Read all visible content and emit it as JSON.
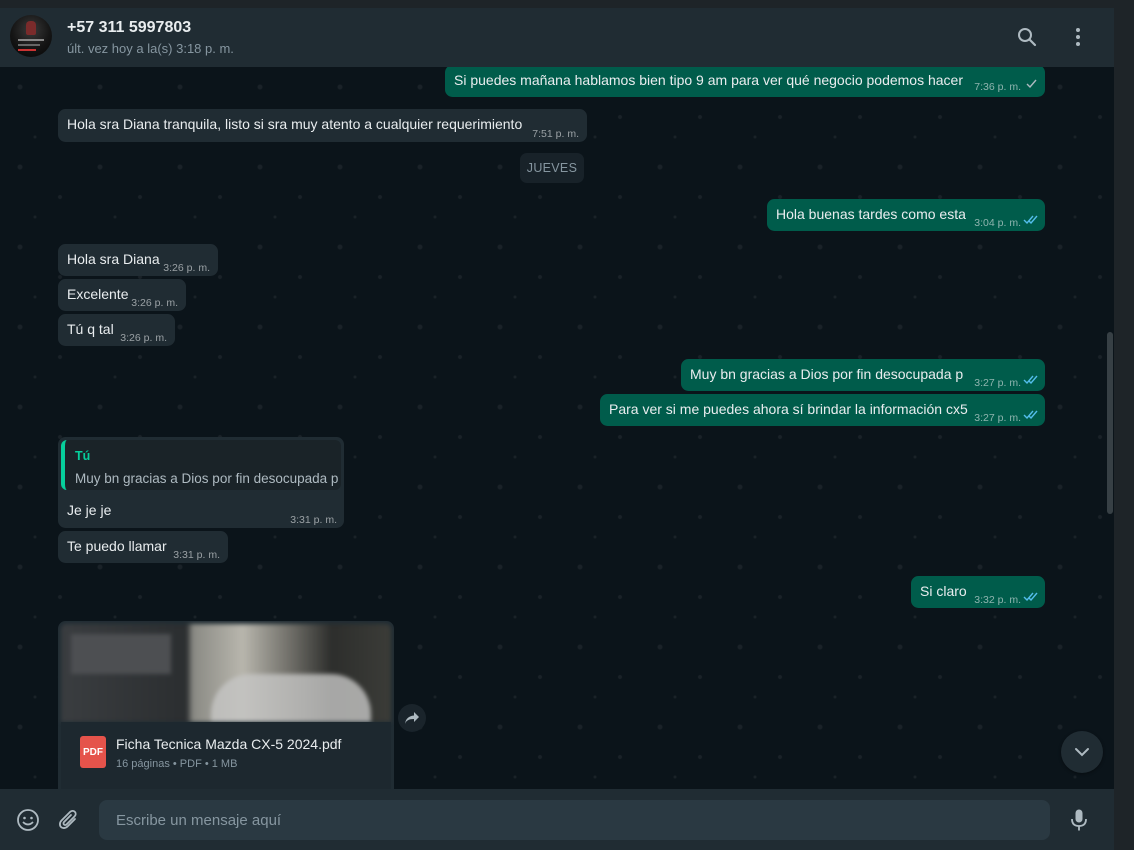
{
  "header": {
    "contact_name": "+57 311 5997803",
    "last_seen": "últ. vez hoy a la(s) 3:18 p. m.",
    "search_icon": "search-icon",
    "menu_icon": "more-vertical-icon"
  },
  "day_separator": "JUEVES",
  "messages": [
    {
      "dir": "out",
      "text": "Si puedes mañana hablamos bien tipo 9 am para ver qué negocio podemos hacer",
      "time": "7:36 p. m.",
      "status": "sent"
    },
    {
      "dir": "in",
      "text": "Hola sra Diana tranquila, listo si sra muy atento a cualquier requerimiento",
      "time": "7:51 p. m."
    },
    {
      "dir": "out",
      "text": "Hola buenas tardes como esta",
      "time": "3:04 p. m.",
      "status": "read"
    },
    {
      "dir": "in",
      "text": "Hola sra Diana",
      "time": "3:26 p. m."
    },
    {
      "dir": "in",
      "text": "Excelente",
      "time": "3:26 p. m."
    },
    {
      "dir": "in",
      "text": "Tú q tal",
      "time": "3:26 p. m."
    },
    {
      "dir": "out",
      "text": "Muy bn gracias a Dios por fin desocupada p",
      "time": "3:27 p. m.",
      "status": "read"
    },
    {
      "dir": "out",
      "text": "Para ver si me puedes ahora sí brindar la información cx5",
      "time": "3:27 p. m.",
      "status": "read"
    },
    {
      "dir": "in",
      "text": "Te puedo llamar",
      "time": "3:31 p. m."
    },
    {
      "dir": "out",
      "text": "Si claro",
      "time": "3:32 p. m.",
      "status": "read"
    }
  ],
  "reply_message": {
    "quote_author": "Tú",
    "quote_text": "Muy bn gracias a Dios por fin desocupada p",
    "text": "Je je je",
    "time": "3:31 p. m."
  },
  "document": {
    "icon_label": "PDF",
    "name": "Ficha Tecnica Mazda CX-5 2024.pdf",
    "meta": "16 páginas • PDF • 1 MB"
  },
  "composer": {
    "placeholder": "Escribe un mensaje aquí",
    "emoji_icon": "emoji-icon",
    "attach_icon": "paperclip-icon",
    "mic_icon": "microphone-icon"
  },
  "colors": {
    "incoming_bubble": "#202c33",
    "outgoing_bubble": "#005c4b",
    "read_tick": "#53bdeb",
    "accent": "#06cf9c"
  }
}
